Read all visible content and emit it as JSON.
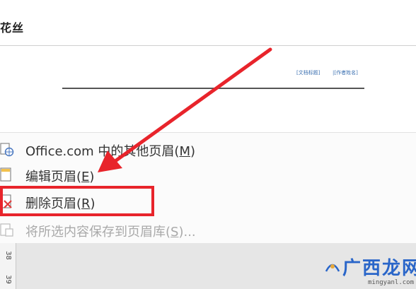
{
  "title": {
    "text": "花丝"
  },
  "gallery": {
    "doc_title_field": "[文档标题]",
    "author_field": "|[作者姓名]"
  },
  "menu": {
    "items": [
      {
        "label": "Office.com 中的其他页眉(",
        "key": "M",
        "close": ")",
        "disabled": false,
        "icon": "web-gallery-icon"
      },
      {
        "label": "编辑页眉(",
        "key": "E",
        "close": ")",
        "disabled": false,
        "icon": "edit-header-icon"
      },
      {
        "label": "删除页眉(",
        "key": "R",
        "close": ")",
        "disabled": false,
        "icon": "delete-header-icon"
      },
      {
        "label": "将所选内容保存到页眉库(",
        "key": "S",
        "close": ")...",
        "disabled": true,
        "icon": "save-to-gallery-icon"
      }
    ]
  },
  "ruler": {
    "numbers": [
      "38",
      "39"
    ]
  },
  "watermark": {
    "brand": "广西龙网",
    "url": "mingyanl.com"
  },
  "colors": {
    "highlight": "#e8242b",
    "field_blue": "#3a6fb0",
    "brand_blue": "#2a66c9"
  }
}
